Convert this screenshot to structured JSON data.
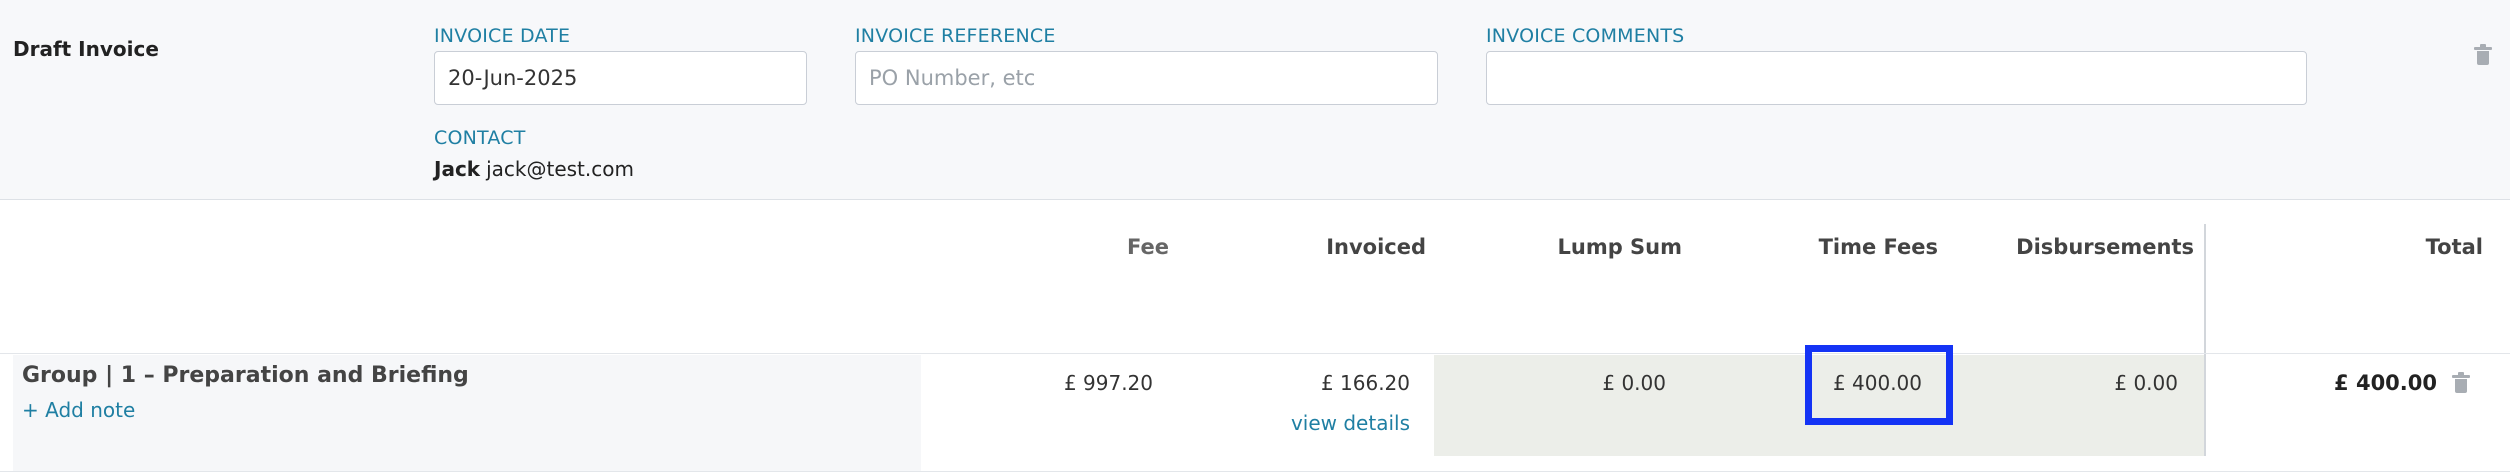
{
  "header": {
    "title": "Draft Invoice",
    "invoice_date": {
      "label": "INVOICE DATE",
      "value": "20-Jun-2025"
    },
    "invoice_reference": {
      "label": "INVOICE REFERENCE",
      "placeholder": "PO Number, etc",
      "value": ""
    },
    "invoice_comments": {
      "label": "INVOICE COMMENTS",
      "value": ""
    },
    "contact": {
      "label": "CONTACT",
      "name": "Jack",
      "email": "jack@test.com"
    }
  },
  "table": {
    "columns": {
      "fee": "Fee",
      "invoiced": "Invoiced",
      "lump_sum": "Lump Sum",
      "time_fees": "Time Fees",
      "disbursements": "Disbursements",
      "total": "Total"
    },
    "rows": [
      {
        "title": "Group | 1 – Preparation and Briefing",
        "add_note": "+ Add note",
        "fee": "£ 997.20",
        "invoiced": "£ 166.20",
        "view_details": "view details",
        "lump_sum": "£ 0.00",
        "time_fees": "£ 400.00",
        "disbursements": "£ 0.00",
        "total": "£ 400.00"
      }
    ]
  },
  "colors": {
    "accent": "#1f7fa3",
    "highlight": "#1433f5",
    "header_bg": "#f7f8fa",
    "gray_cells": "#eceee9"
  }
}
